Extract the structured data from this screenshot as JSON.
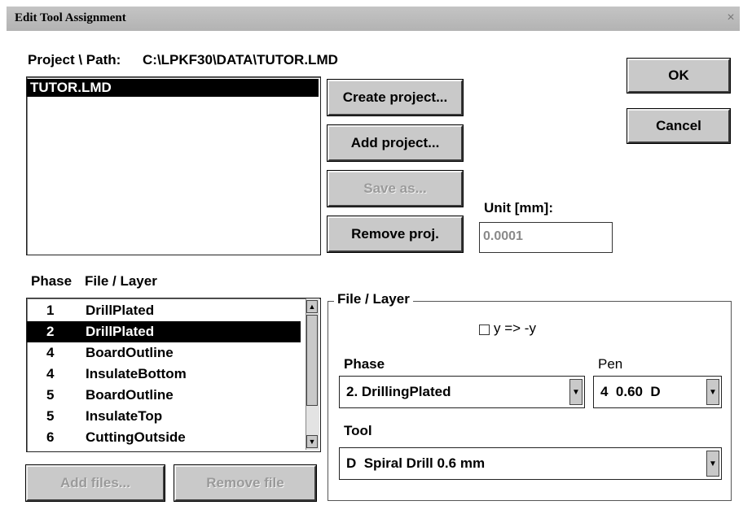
{
  "window": {
    "title": "Edit Tool Assignment",
    "close_symbol": "×"
  },
  "project": {
    "path_label": "Project \\ Path:",
    "path_value": "C:\\LPKF30\\DATA\\TUTOR.LMD",
    "list_items": [
      "TUTOR.LMD"
    ],
    "selected_index": 0
  },
  "buttons": {
    "ok": "OK",
    "cancel": "Cancel",
    "create_project": "Create project...",
    "add_project": "Add project...",
    "save_as": "Save as...",
    "remove_proj": "Remove proj.",
    "add_files": "Add files...",
    "remove_file": "Remove file"
  },
  "unit": {
    "label": "Unit [mm]:",
    "value": "0.0001"
  },
  "layers": {
    "headers": {
      "phase": "Phase",
      "file": "File / Layer"
    },
    "rows": [
      {
        "phase": "1",
        "file": "DrillPlated"
      },
      {
        "phase": "2",
        "file": "DrillPlated"
      },
      {
        "phase": "4",
        "file": "BoardOutline"
      },
      {
        "phase": "4",
        "file": "InsulateBottom"
      },
      {
        "phase": "5",
        "file": "BoardOutline"
      },
      {
        "phase": "5",
        "file": "InsulateTop"
      },
      {
        "phase": "6",
        "file": "CuttingOutside"
      }
    ],
    "selected_index": 1
  },
  "file_layer_group": {
    "title": "File / Layer",
    "mirror_label": "y => -y",
    "mirror_checked": false,
    "phase_label": "Phase",
    "phase_value": "2. DrillingPlated",
    "pen_label": "Pen",
    "pen_value": "4  0.60  D",
    "tool_label": "Tool",
    "tool_value": "D  Spiral Drill 0.6 mm"
  },
  "icons": {
    "scroll_up": "▲",
    "scroll_down": "▼",
    "dropdown": "▼"
  }
}
